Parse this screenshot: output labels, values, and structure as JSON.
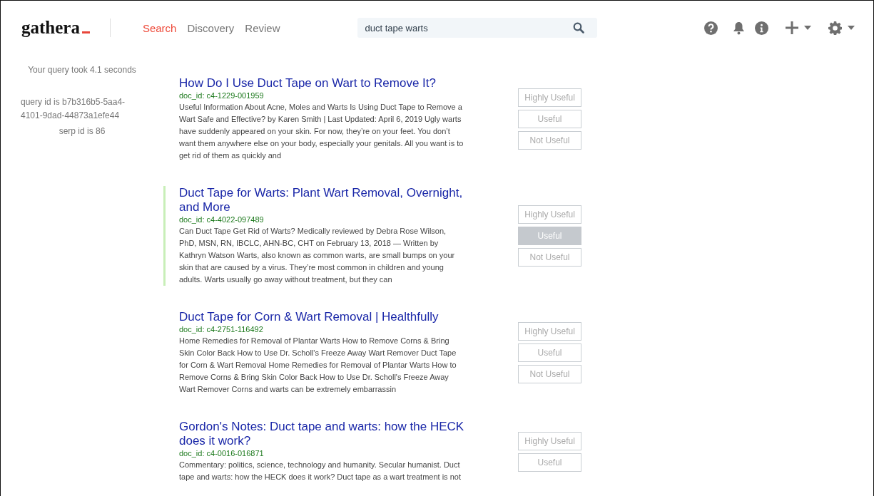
{
  "header": {
    "logo": "gathera",
    "nav": [
      {
        "label": "Search",
        "selected": true
      },
      {
        "label": "Discovery",
        "selected": false
      },
      {
        "label": "Review",
        "selected": false
      }
    ],
    "search": {
      "value": "duct tape warts"
    }
  },
  "sidebar": {
    "query_time": "Your query took 4.1 seconds",
    "query_id": "query id is b7b316b5-5aa4-4101-9dad-44873a1efe44",
    "serp_id": "serp id is 86"
  },
  "results": [
    {
      "title": "How Do I Use Duct Tape on Wart to Remove It?",
      "doc_id": "doc_id: c4-1229-001959",
      "snippet": "Useful Information About Acne, Moles and Warts Is Using Duct Tape to Remove a Wart Safe and Effective? by Karen Smith | Last Updated: April 6, 2019 Ugly warts have suddenly appeared on your skin. For now, they’re on your feet. You don’t want them anywhere else on your body, especially your genitals. All you want is to get rid of them as quickly and",
      "highlighted": false,
      "ratings": [
        {
          "label": "Highly Useful",
          "selected": false
        },
        {
          "label": "Useful",
          "selected": false
        },
        {
          "label": "Not Useful",
          "selected": false
        }
      ]
    },
    {
      "title": "Duct Tape for Warts: Plant Wart Removal, Overnight, and More",
      "doc_id": "doc_id: c4-4022-097489",
      "snippet": "Can Duct Tape Get Rid of Warts? Medically reviewed by Debra Rose Wilson, PhD, MSN, RN, IBCLC, AHN-BC, CHT on February 13, 2018 — Written by Kathryn Watson Warts, also known as common warts, are small bumps on your skin that are caused by a virus. They’re most common in children and young adults. Warts usually go away without treatment, but they can",
      "highlighted": true,
      "ratings": [
        {
          "label": "Highly Useful",
          "selected": false
        },
        {
          "label": "Useful",
          "selected": true
        },
        {
          "label": "Not Useful",
          "selected": false
        }
      ]
    },
    {
      "title": "Duct Tape for Corn & Wart Removal | Healthfully",
      "doc_id": "doc_id: c4-2751-116492",
      "snippet": "Home Remedies for Removal of Plantar Warts How to Remove Corns & Bring Skin Color Back How to Use Dr. Scholl's Freeze Away Wart Remover Duct Tape for Corn & Wart Removal Home Remedies for Removal of Plantar Warts How to Remove Corns & Bring Skin Color Back How to Use Dr. Scholl's Freeze Away Wart Remover Corns and warts can be extremely embarrassin",
      "highlighted": false,
      "ratings": [
        {
          "label": "Highly Useful",
          "selected": false
        },
        {
          "label": "Useful",
          "selected": false
        },
        {
          "label": "Not Useful",
          "selected": false
        }
      ]
    },
    {
      "title": "Gordon's Notes: Duct tape and warts: how the HECK does it work?",
      "doc_id": "doc_id: c4-0016-016871",
      "snippet": "Commentary: politics, science, technology and humanity. Secular humanist. Duct tape and warts: how the HECK does it work? Duct tape as a wart treatment is not",
      "highlighted": false,
      "ratings": [
        {
          "label": "Highly Useful",
          "selected": false
        },
        {
          "label": "Useful",
          "selected": false
        }
      ]
    }
  ]
}
